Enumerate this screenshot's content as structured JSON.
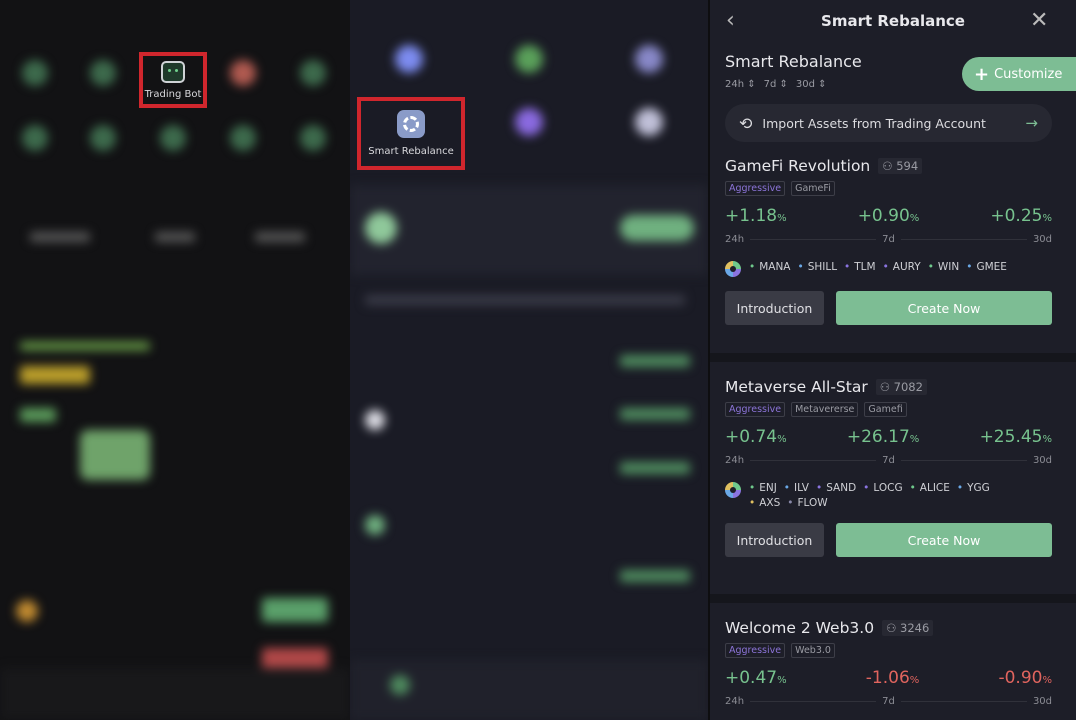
{
  "left_panel": {
    "highlighted_item": "Trading Bot"
  },
  "middle_panel": {
    "highlighted_item": "Smart Rebalance"
  },
  "right_panel": {
    "header_title": "Smart Rebalance",
    "back_icon": "chevron-left-icon",
    "close_icon": "close-icon",
    "section_title": "Smart Rebalance",
    "sort_options": [
      "24h ⇕",
      "7d ⇕",
      "30d ⇕"
    ],
    "customize_label": "Customize",
    "import_label": "Import Assets from Trading Account",
    "accent_color": "#7dbd94",
    "portfolios": [
      {
        "name": "GameFi Revolution",
        "users": "594",
        "tags": [
          "Aggressive",
          "GameFi"
        ],
        "returns": [
          {
            "value": "+1.18",
            "dir": "g"
          },
          {
            "value": "+0.90",
            "dir": "g"
          },
          {
            "value": "+0.25",
            "dir": "g"
          }
        ],
        "coins": [
          "MANA",
          "SHILL",
          "TLM",
          "AURY",
          "WIN",
          "GMEE"
        ]
      },
      {
        "name": "Metaverse All-Star",
        "users": "7082",
        "tags": [
          "Aggressive",
          "Metavererse",
          "Gamefi"
        ],
        "returns": [
          {
            "value": "+0.74",
            "dir": "g"
          },
          {
            "value": "+26.17",
            "dir": "g"
          },
          {
            "value": "+25.45",
            "dir": "g"
          }
        ],
        "coins": [
          "ENJ",
          "ILV",
          "SAND",
          "LOCG",
          "ALICE",
          "YGG",
          "AXS",
          "FLOW"
        ]
      },
      {
        "name": "Welcome 2 Web3.0",
        "users": "3246",
        "tags": [
          "Aggressive",
          "Web3.0"
        ],
        "returns": [
          {
            "value": "+0.47",
            "dir": "g"
          },
          {
            "value": "-1.06",
            "dir": "r"
          },
          {
            "value": "-0.90",
            "dir": "r"
          }
        ],
        "coins": []
      }
    ],
    "periods": [
      "24h",
      "7d",
      "30d"
    ],
    "percent": "%",
    "intro_label": "Introduction",
    "create_label": "Create Now"
  }
}
